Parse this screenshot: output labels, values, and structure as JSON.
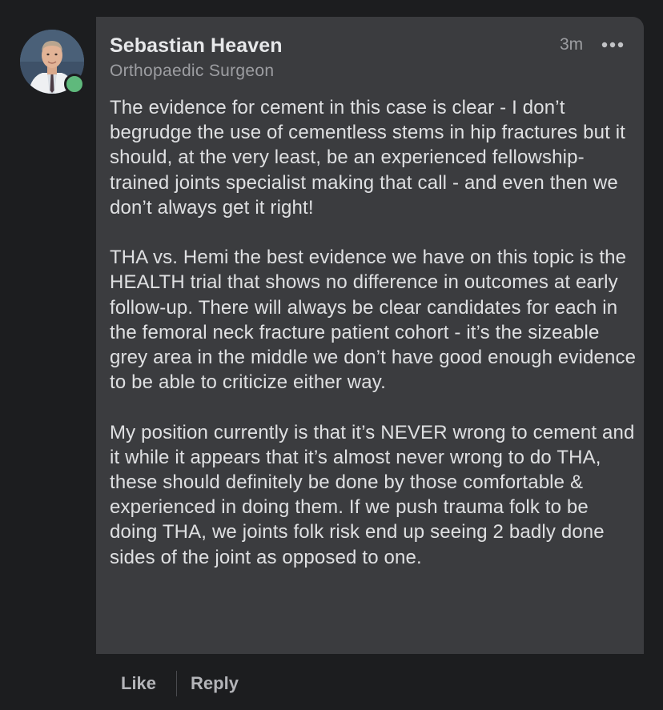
{
  "comment": {
    "author_name": "Sebastian Heaven",
    "author_role": "Orthopaedic Surgeon",
    "time": "3m",
    "online_status": "online",
    "more_icon": "more-horizontal-icon",
    "paragraphs": [
      "The evidence for cement in this case is clear - I don’t begrudge the use of cementless stems in hip fractures but it should, at the very least, be an experienced fellowship-trained joints specialist making that call - and even then we don’t always get it right!",
      "THA vs. Hemi the best evidence we have on this topic is the HEALTH trial that shows no difference in outcomes at early follow-up. There will always be clear candidates for each in the femoral neck fracture patient cohort - it’s the sizeable grey area in the middle we don’t have good enough evidence to be able to criticize either way.",
      "My position currently is that it’s NEVER wrong to cement and it while it appears that it’s almost never wrong to do THA, these should definitely be done by those comfortable & experienced in doing them. If we push trauma folk to be doing THA, we joints folk risk end up seeing 2 badly done sides of the joint as opposed to one."
    ]
  },
  "actions": {
    "like_label": "Like",
    "reply_label": "Reply"
  },
  "colors": {
    "background": "#1c1d1f",
    "bubble": "#3b3c3f",
    "online": "#5fb97c"
  }
}
